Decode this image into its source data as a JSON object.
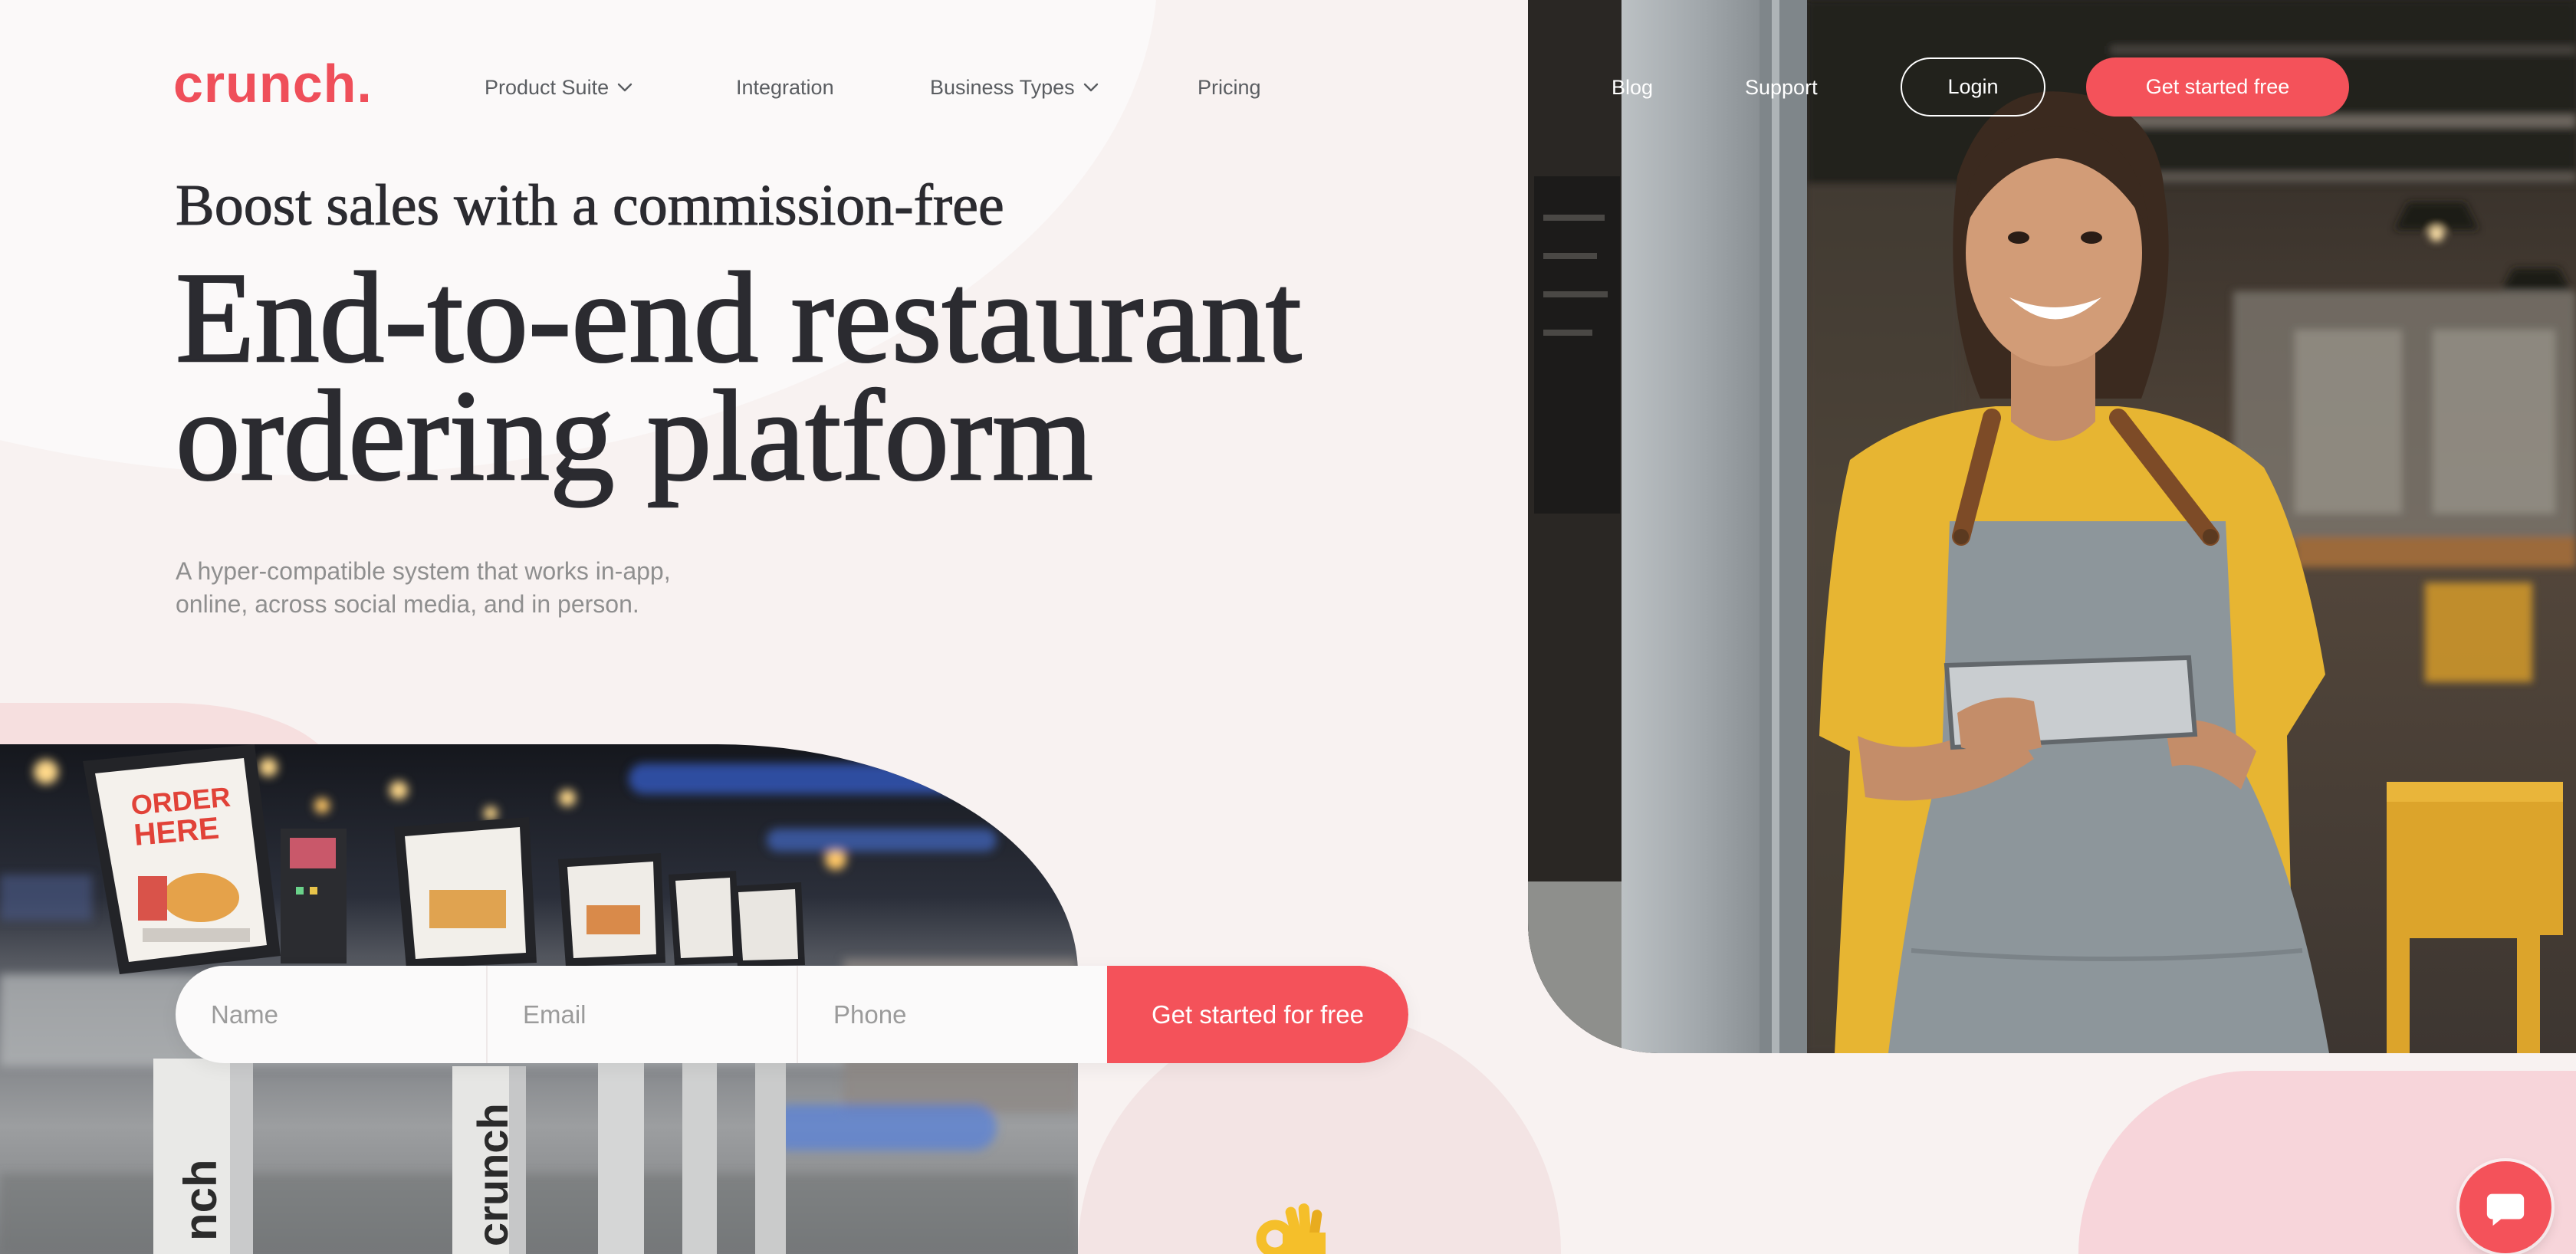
{
  "colors": {
    "accent": "#f4525a",
    "logo": "#ef4f5a",
    "background": "#f8f2f1",
    "text_dark": "#2b2b30",
    "text_muted": "#8f8f8f"
  },
  "header": {
    "logo_text": "crunch.",
    "nav": [
      {
        "label": "Product Suite",
        "icon": "chevron-down-icon"
      },
      {
        "label": "Integration"
      },
      {
        "label": "Business Types",
        "icon": "chevron-down-icon"
      },
      {
        "label": "Pricing"
      }
    ],
    "secondary_nav": [
      {
        "label": "Blog"
      },
      {
        "label": "Support"
      }
    ],
    "login_label": "Login",
    "cta_label": "Get started free"
  },
  "hero": {
    "eyebrow": "Boost sales with a commission-free",
    "title_line1": "End-to-end restaurant",
    "title_line2": "ordering platform",
    "subtitle_line1": "A hyper-compatible system that works in-app,",
    "subtitle_line2": "online, across social media, and in person."
  },
  "signup_form": {
    "name_placeholder": "Name",
    "email_placeholder": "Email",
    "phone_placeholder": "Phone",
    "submit_label": "Get started for free"
  },
  "kiosk_photo": {
    "sign_line1": "ORDER",
    "sign_line2": "HERE",
    "stand_labels": [
      "nch",
      "crunch"
    ]
  },
  "icons": {
    "chat": "chat-bubble-icon",
    "emoji": "ok-hand-icon",
    "dropdown": "chevron-down-icon"
  }
}
